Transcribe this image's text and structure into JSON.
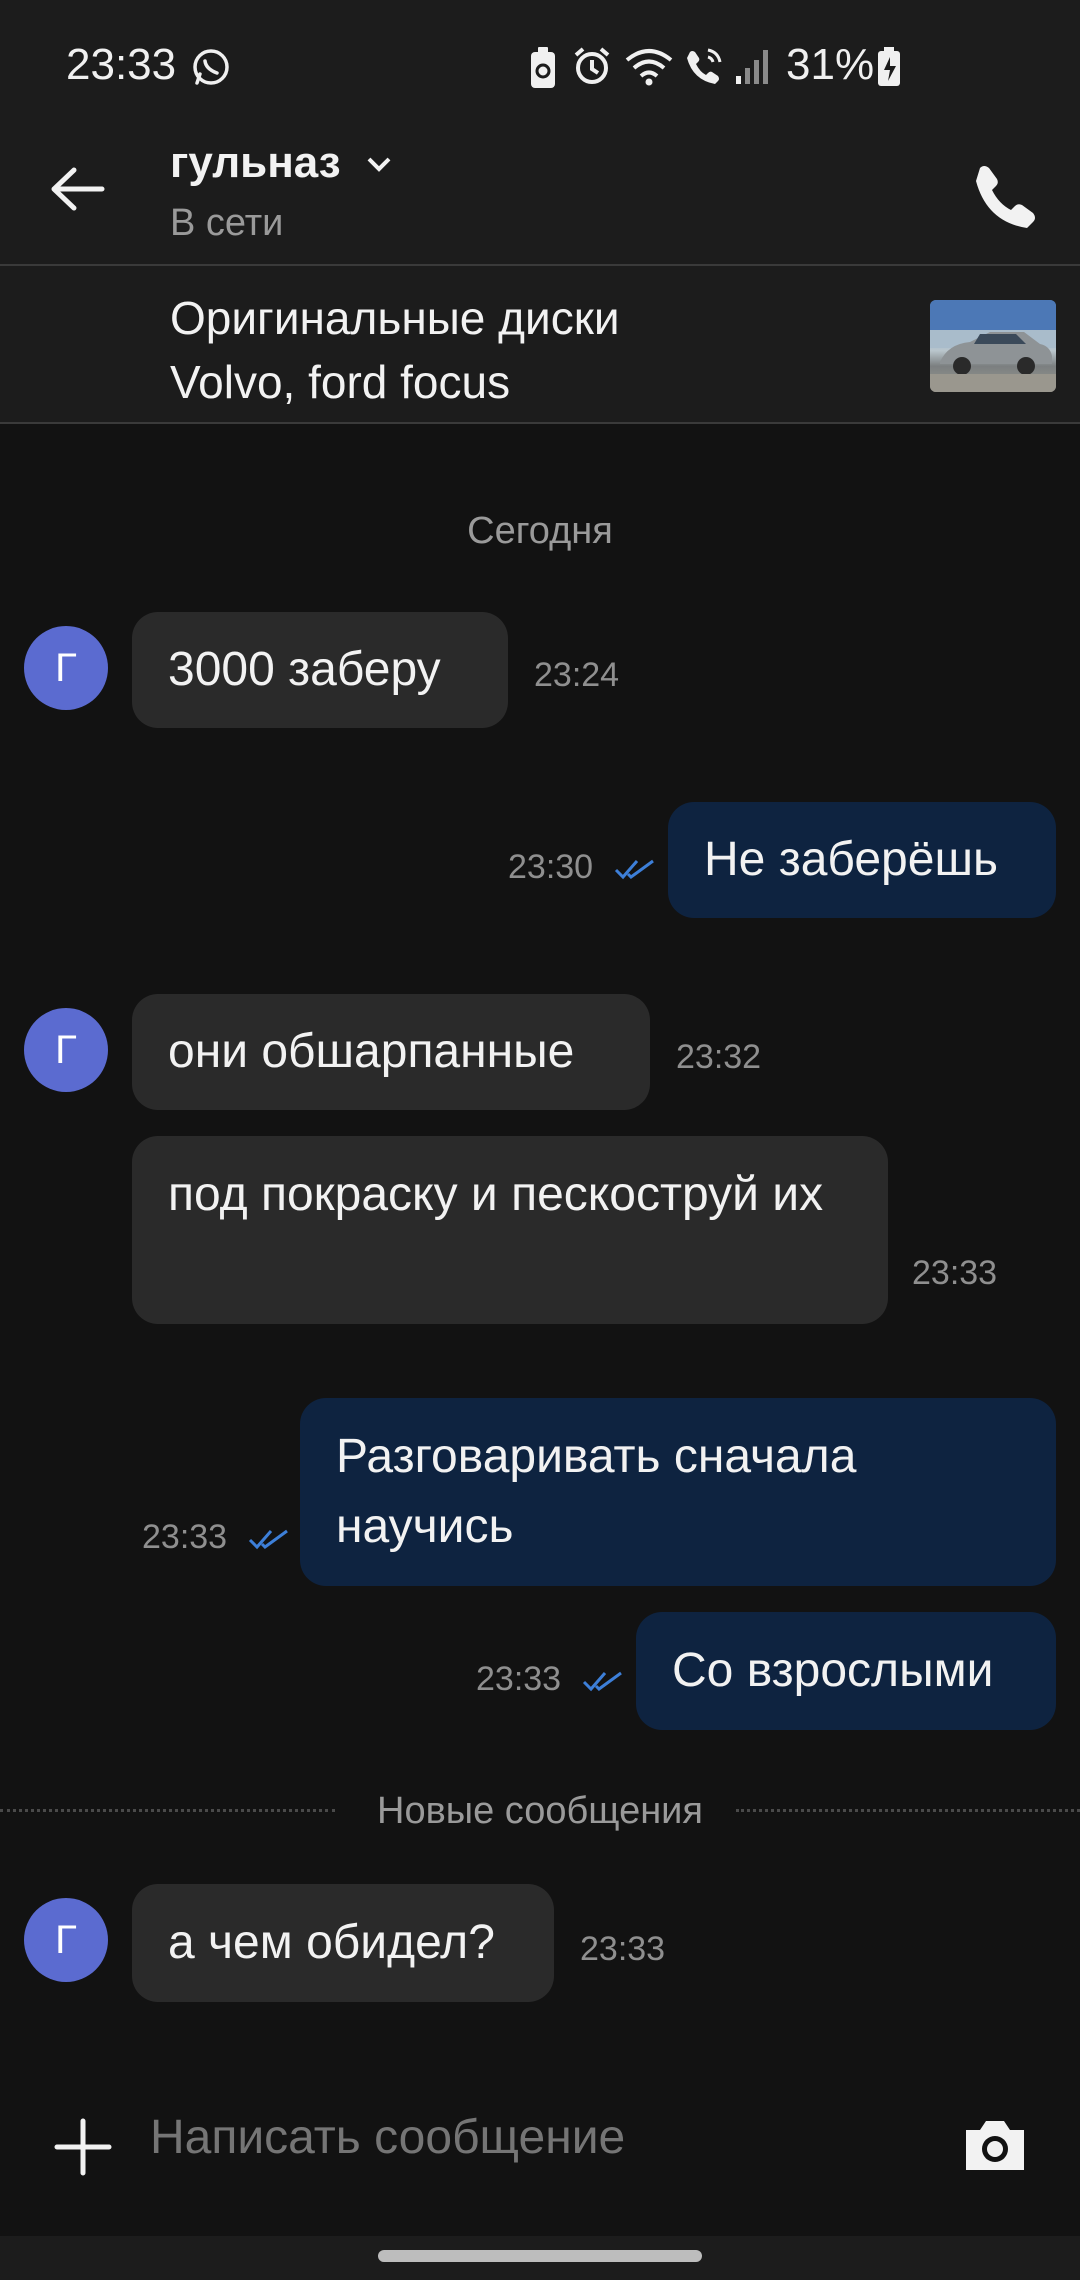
{
  "status_bar": {
    "time": "23:33",
    "battery_percent": "31%",
    "icons": [
      "whatsapp-icon",
      "battery-saver-icon",
      "alarm-icon",
      "wifi-icon",
      "wifi-calling-icon",
      "signal-icon",
      "battery-charging-icon"
    ]
  },
  "header": {
    "contact_name": "гульназ",
    "contact_status": "В сети",
    "back_icon": "arrow-left-icon",
    "call_icon": "phone-icon"
  },
  "listing": {
    "title": "Оригинальные диски Volvo, ford focus"
  },
  "chat": {
    "date_separator": "Сегодня",
    "new_messages_label": "Новые сообщения",
    "avatar_letter": "Г",
    "messages": [
      {
        "direction": "in",
        "text": "3000 заберу",
        "time": "23:24"
      },
      {
        "direction": "out",
        "text": "Не заберёшь",
        "time": "23:30",
        "read": true
      },
      {
        "direction": "in",
        "text": "они обшарпанные",
        "time": "23:32"
      },
      {
        "direction": "in",
        "text": "под покраску и пескоструй их",
        "time": "23:33"
      },
      {
        "direction": "out",
        "text": "Разговаривать сначала научись",
        "time": "23:33",
        "read": true
      },
      {
        "direction": "out",
        "text": "Со взрослыми",
        "time": "23:33",
        "read": true
      },
      {
        "direction": "in",
        "text": "а чем обидел?",
        "time": "23:33"
      }
    ]
  },
  "composer": {
    "placeholder": "Написать сообщение",
    "attach_icon": "plus-icon",
    "camera_icon": "camera-icon"
  },
  "colors": {
    "background": "#121212",
    "bar": "#1c1c1c",
    "incoming_bubble": "#2a2a2a",
    "outgoing_bubble": "#0e2340",
    "avatar": "#5b6bd0",
    "read_ticks": "#3d7fd8"
  }
}
